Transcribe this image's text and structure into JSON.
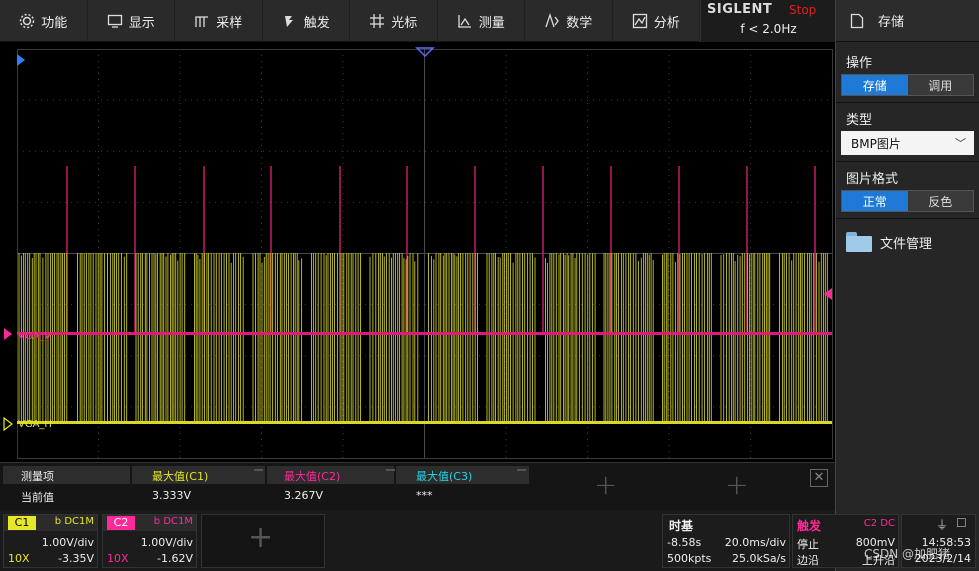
{
  "menu": [
    {
      "label": "功能",
      "icon": "gear-icon"
    },
    {
      "label": "显示",
      "icon": "monitor-icon"
    },
    {
      "label": "采样",
      "icon": "acquire-icon"
    },
    {
      "label": "触发",
      "icon": "trigger-icon"
    },
    {
      "label": "光标",
      "icon": "cursor-icon"
    },
    {
      "label": "测量",
      "icon": "measure-icon"
    },
    {
      "label": "数学",
      "icon": "math-icon"
    },
    {
      "label": "分析",
      "icon": "analysis-icon"
    }
  ],
  "brand": {
    "logo": "SIGLENT",
    "run_state": "Stop",
    "frequency": "f < 2.0Hz"
  },
  "panel": {
    "title": "存储",
    "operation_label": "操作",
    "operation_options": [
      "存储",
      "调用"
    ],
    "operation_selected": 0,
    "type_label": "类型",
    "type_value": "BMP图片",
    "format_label": "图片格式",
    "format_options": [
      "正常",
      "反色"
    ],
    "format_selected": 0,
    "file_manager": "文件管理"
  },
  "channels_on_screen": {
    "c2_label": "VGA_V",
    "c1_label": "VGA_H"
  },
  "measurements": {
    "col0_header": "测量项",
    "col0_value": "当前值",
    "items": [
      {
        "header": "最大值(C1)",
        "value": "3.333V",
        "color": "#e6e62a"
      },
      {
        "header": "最大值(C2)",
        "value": "3.267V",
        "color": "#ff2a9a"
      },
      {
        "header": "最大值(C3)",
        "value": "***",
        "color": "#27d4e6"
      }
    ]
  },
  "ch1": {
    "name": "C1",
    "coupling": "b DC1M",
    "vdiv": "1.00V/div",
    "probe": "10X",
    "offset": "-3.35V",
    "color": "#e6e62a"
  },
  "ch2": {
    "name": "C2",
    "coupling": "b DC1M",
    "vdiv": "1.00V/div",
    "probe": "10X",
    "offset": "-1.62V",
    "color": "#ff2a9a"
  },
  "timebase": {
    "title": "时基",
    "delay": "-8.58s",
    "tdiv": "20.0ms/div",
    "points": "500kpts",
    "rate": "25.0kSa/s"
  },
  "trigger": {
    "title": "触发",
    "source": "C2 DC",
    "mode": "停止",
    "level": "800mV",
    "edge_label": "边沿",
    "slope": "上升沿"
  },
  "clock": {
    "time": "14:58:53",
    "date": "2023/2/14"
  },
  "watermark": "CSDN @加肥猪"
}
